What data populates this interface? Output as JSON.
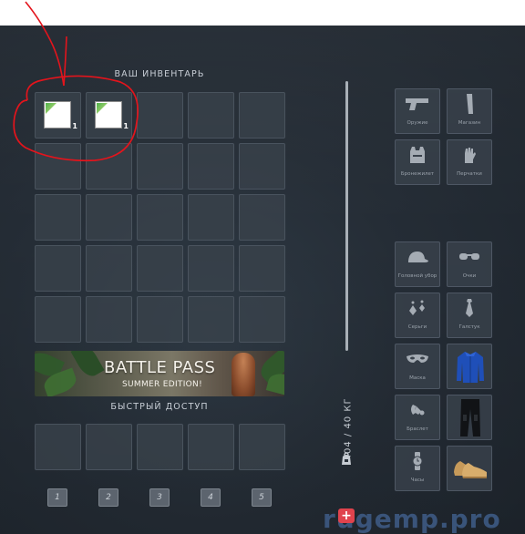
{
  "inventory": {
    "title": "ВАШ ИНВЕНТАРЬ",
    "slots": [
      {
        "has_item": true,
        "count": "1"
      },
      {
        "has_item": true,
        "count": "1"
      },
      {
        "has_item": false
      },
      {
        "has_item": false
      },
      {
        "has_item": false
      },
      {
        "has_item": false
      },
      {
        "has_item": false
      },
      {
        "has_item": false
      },
      {
        "has_item": false
      },
      {
        "has_item": false
      },
      {
        "has_item": false
      },
      {
        "has_item": false
      },
      {
        "has_item": false
      },
      {
        "has_item": false
      },
      {
        "has_item": false
      },
      {
        "has_item": false
      },
      {
        "has_item": false
      },
      {
        "has_item": false
      },
      {
        "has_item": false
      },
      {
        "has_item": false
      },
      {
        "has_item": false
      },
      {
        "has_item": false
      },
      {
        "has_item": false
      },
      {
        "has_item": false
      },
      {
        "has_item": false
      }
    ]
  },
  "banner": {
    "title": "BATTLE PASS",
    "subtitle": "SUMMER EDITION!"
  },
  "quick_access": {
    "title": "БЫСТРЫЙ ДОСТУП",
    "keys": [
      "1",
      "2",
      "3",
      "4",
      "5"
    ]
  },
  "weight": {
    "text": "0.04 / 40 КГ"
  },
  "equipment": {
    "weapons": [
      {
        "label": "Оружие",
        "icon": "pistol-icon"
      },
      {
        "label": "Магазин",
        "icon": "magazine-icon"
      },
      {
        "label": "Бронежилет",
        "icon": "vest-icon"
      },
      {
        "label": "Перчатки",
        "icon": "gloves-icon"
      }
    ],
    "clothes": [
      {
        "label": "Головной убор",
        "icon": "cap-icon"
      },
      {
        "label": "Очки",
        "icon": "glasses-icon"
      },
      {
        "label": "Серьги",
        "icon": "earrings-icon"
      },
      {
        "label": "Галстук",
        "icon": "tie-icon"
      },
      {
        "label": "Маска",
        "icon": "mask-icon"
      },
      {
        "label": "",
        "icon": "blue-jacket-icon"
      },
      {
        "label": "Браслет",
        "icon": "bracelet-icon"
      },
      {
        "label": "",
        "icon": "black-pants-icon"
      },
      {
        "label": "Часы",
        "icon": "watch-icon"
      },
      {
        "label": "",
        "icon": "brown-shoes-icon"
      }
    ]
  },
  "watermark": "rugemp.pro",
  "colors": {
    "panel_bg": "#252d36",
    "slot_bg": "#3a424c",
    "annotation_red": "#e3141c",
    "plus_red": "#e0434d",
    "watermark_blue": "#3f5d88"
  }
}
